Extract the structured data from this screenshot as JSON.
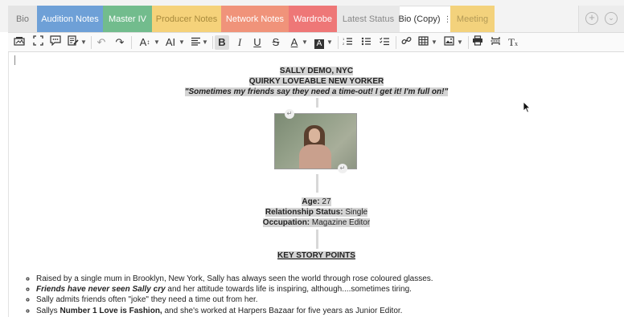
{
  "tabs": [
    {
      "label": "Bio",
      "color": "#e4e4e4",
      "text": "#777777"
    },
    {
      "label": "Audition Notes",
      "color": "#6ea0d7",
      "text": "#ffffff"
    },
    {
      "label": "Master IV",
      "color": "#72bc8d",
      "text": "#ffffff"
    },
    {
      "label": "Producer Notes",
      "color": "#f5d27a",
      "text": "#a88a3c"
    },
    {
      "label": "Network Notes",
      "color": "#f0937a",
      "text": "#ffffff"
    },
    {
      "label": "Wardrobe",
      "color": "#ee7777",
      "text": "#ffffff"
    },
    {
      "label": "Latest Status",
      "color": "#e8e8e8",
      "text": "#888888"
    },
    {
      "label": "Bio (Copy)",
      "color": "#ffffff",
      "text": "#333333",
      "active": true
    },
    {
      "label": "Meeting",
      "color": "#f3d27c",
      "text": "#b39a56"
    }
  ],
  "tab_actions": {
    "add_icon": "plus-circle-icon",
    "more_icon": "chevron-down-circle-icon"
  },
  "toolbar": {
    "font_size_label": "A",
    "font_family_label": "AI",
    "bold_label": "B",
    "italic_label": "I",
    "underline_label": "U",
    "strike_label": "S",
    "text_color_label": "A",
    "highlight_label": "A",
    "clear_format_label": "T"
  },
  "doc": {
    "heading1": "SALLY DEMO, NYC",
    "heading2": "QUIRKY LOVEABLE NEW YORKER",
    "quote": "\"Sometimes my friends say they need a time-out! I get it! I'm full on!\"",
    "age_label": "Age:",
    "age_value": " 27",
    "relationship_label": "Relationship Status:",
    "relationship_value": " Single",
    "occupation_label": "Occupation:",
    "occupation_value": " Magazine Editor",
    "key_points_title": "KEY STORY POINTS",
    "bullets": {
      "b1": "Raised by a single mum in Brooklyn, New York, Sally has always seen the world through rose coloured glasses.",
      "b2_bold": "Friends have never seen Sally cry",
      "b2_rest": " and her attitude towards life is inspiring, although....sometimes tiring.",
      "b3": "Sally admits friends often \"joke\" they need a time out from her.",
      "b4_pre": "Sallys ",
      "b4_bold": "Number 1 Love is Fashion,",
      "b4_rest": " and she's worked at Harpers Bazaar for five years as Junior Editor."
    }
  }
}
